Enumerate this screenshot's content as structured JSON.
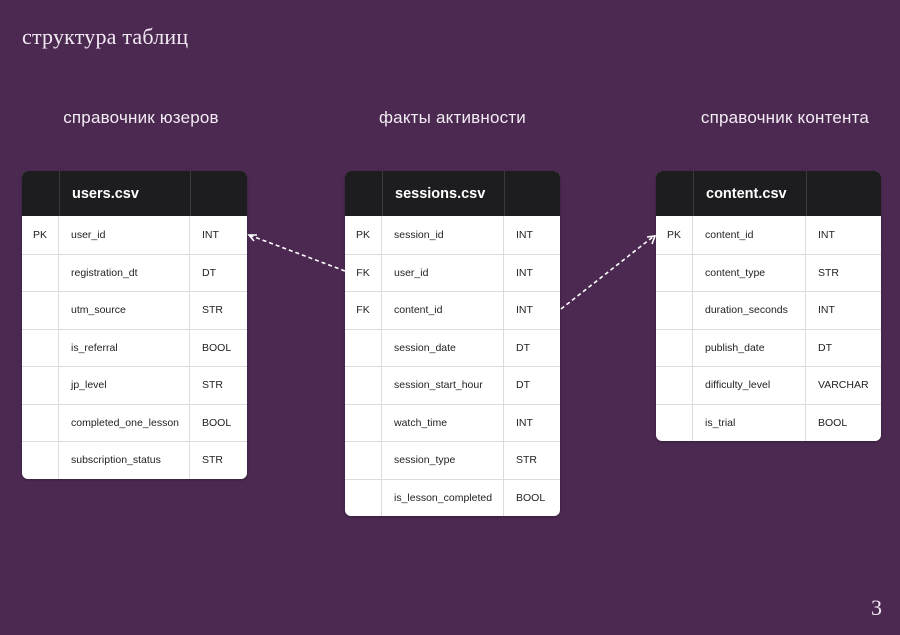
{
  "slide": {
    "title": "структура таблиц",
    "page_number": "3"
  },
  "sections": {
    "users": "справочник юзеров",
    "sessions": "факты активности",
    "content": "справочник контента"
  },
  "tables": {
    "users": {
      "name": "users.csv",
      "rows": [
        {
          "key": "PK",
          "field": "user_id",
          "type": "INT"
        },
        {
          "key": "",
          "field": "registration_dt",
          "type": "DT"
        },
        {
          "key": "",
          "field": "utm_source",
          "type": "STR"
        },
        {
          "key": "",
          "field": "is_referral",
          "type": "BOOL"
        },
        {
          "key": "",
          "field": "jp_level",
          "type": "STR"
        },
        {
          "key": "",
          "field": "completed_one_lesson",
          "type": "BOOL"
        },
        {
          "key": "",
          "field": "subscription_status",
          "type": "STR"
        }
      ]
    },
    "sessions": {
      "name": "sessions.csv",
      "rows": [
        {
          "key": "PK",
          "field": "session_id",
          "type": "INT"
        },
        {
          "key": "FK",
          "field": "user_id",
          "type": "INT"
        },
        {
          "key": "FK",
          "field": "content_id",
          "type": "INT"
        },
        {
          "key": "",
          "field": "session_date",
          "type": "DT"
        },
        {
          "key": "",
          "field": "session_start_hour",
          "type": "DT"
        },
        {
          "key": "",
          "field": "watch_time",
          "type": "INT"
        },
        {
          "key": "",
          "field": "session_type",
          "type": "STR"
        },
        {
          "key": "",
          "field": "is_lesson_completed",
          "type": "BOOL"
        }
      ]
    },
    "content": {
      "name": "content.csv",
      "rows": [
        {
          "key": "PK",
          "field": "content_id",
          "type": "INT"
        },
        {
          "key": "",
          "field": "content_type",
          "type": "STR"
        },
        {
          "key": "",
          "field": "duration_seconds",
          "type": "INT"
        },
        {
          "key": "",
          "field": "publish_date",
          "type": "DT"
        },
        {
          "key": "",
          "field": "difficulty_level",
          "type": "VARCHAR"
        },
        {
          "key": "",
          "field": "is_trial",
          "type": "BOOL"
        }
      ]
    }
  },
  "colors": {
    "background": "#4b2951",
    "table_header": "#1d1c1e",
    "connector": "#ffffff"
  }
}
